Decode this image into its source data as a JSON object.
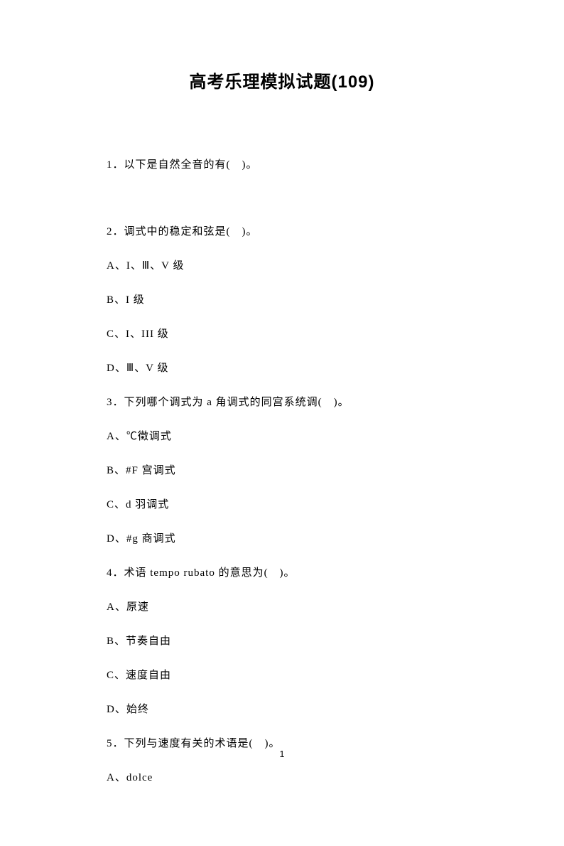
{
  "title": "高考乐理模拟试题(109)",
  "questions": {
    "q1": {
      "text": "1．以下是自然全音的有(　)。"
    },
    "q2": {
      "text": "2．调式中的稳定和弦是(　)。",
      "options": {
        "a": "A、I、Ⅲ、V 级",
        "b": "B、I 级",
        "c": "C、I、III 级",
        "d": "D、Ⅲ、V 级"
      }
    },
    "q3": {
      "text": "3．下列哪个调式为 a 角调式的同宫系统调(　)。",
      "options": {
        "a": "A、℃徵调式",
        "b": "B、#F 宫调式",
        "c": "C、d 羽调式",
        "d": "D、#g 商调式"
      }
    },
    "q4": {
      "text": "4．术语 tempo rubato 的意思为(　)。",
      "options": {
        "a": "A、原速",
        "b": "B、节奏自由",
        "c": "C、速度自由",
        "d": "D、始终"
      }
    },
    "q5": {
      "text": "5．下列与速度有关的术语是(　)。",
      "options": {
        "a": "A、dolce"
      }
    }
  },
  "pageNumber": "1"
}
